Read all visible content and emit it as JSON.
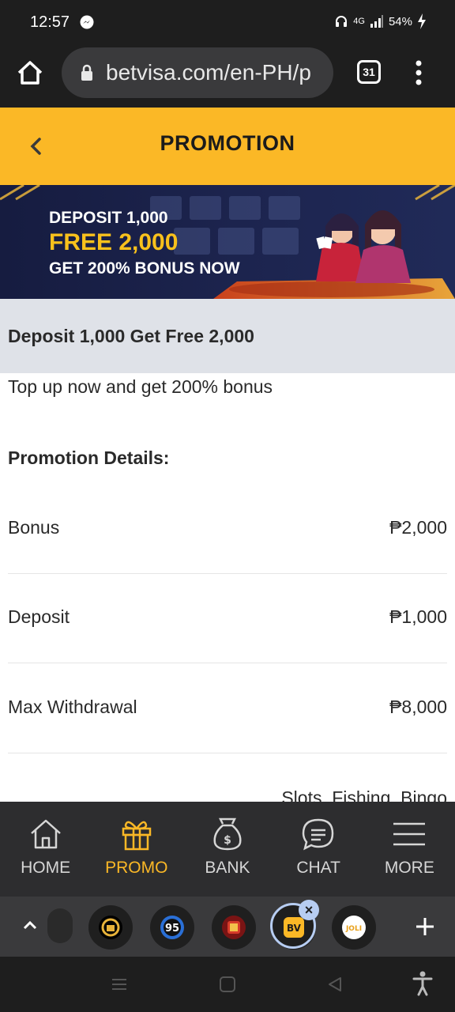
{
  "status_bar": {
    "time": "12:57",
    "network": "4G",
    "battery": "54%",
    "icons": [
      "messenger-icon",
      "headset-icon",
      "signal-icon",
      "battery-charging-icon"
    ]
  },
  "browser": {
    "url": "betvisa.com/en-PH/p",
    "tab_count": "31"
  },
  "header": {
    "title": "PROMOTION"
  },
  "banner": {
    "line1": "DEPOSIT 1,000",
    "line2": "FREE 2,000",
    "line3": "GET 200% BONUS NOW"
  },
  "promo": {
    "title": "Deposit 1,000 Get Free 2,000",
    "description": "Top up now and get 200% bonus",
    "details_heading": "Promotion Details:",
    "details": [
      {
        "label": "Bonus",
        "value": "₱2,000"
      },
      {
        "label": "Deposit",
        "value": "₱1,000"
      },
      {
        "label": "Max Withdrawal",
        "value": "₱8,000"
      }
    ],
    "partial_value": "Slots, Fishing, Bingo"
  },
  "bottom_nav": {
    "items": [
      {
        "label": "HOME",
        "icon": "home-icon",
        "active": false
      },
      {
        "label": "PROMO",
        "icon": "gift-icon",
        "active": true
      },
      {
        "label": "BANK",
        "icon": "money-bag-icon",
        "active": false
      },
      {
        "label": "CHAT",
        "icon": "chat-icon",
        "active": false
      },
      {
        "label": "MORE",
        "icon": "menu-icon",
        "active": false
      }
    ],
    "active_color": "#fbb826"
  },
  "tab_strip": {
    "favicon_text": [
      "95",
      "BV",
      "JOLI"
    ]
  },
  "colors": {
    "accent": "#fbb826",
    "title_bar_bg": "#dfe2e8",
    "dark_bar": "#1e1e1e"
  }
}
